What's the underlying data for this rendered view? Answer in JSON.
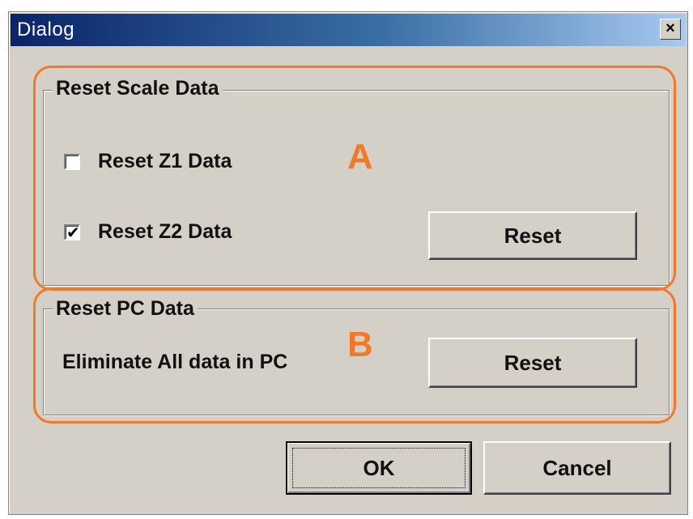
{
  "window": {
    "title": "Dialog",
    "close_glyph": "×"
  },
  "group_a": {
    "legend": "Reset Scale Data",
    "marker": "A",
    "checkboxes": [
      {
        "label": "Reset Z1 Data",
        "checked": false
      },
      {
        "label": "Reset Z2 Data",
        "checked": true
      }
    ],
    "reset_label": "Reset"
  },
  "group_b": {
    "legend": "Reset PC Data",
    "marker": "B",
    "description": "Eliminate All data in PC",
    "reset_label": "Reset"
  },
  "footer": {
    "ok_label": "OK",
    "cancel_label": "Cancel"
  },
  "colors": {
    "highlight": "#f07a2a",
    "title_gradient_start": "#0a246a",
    "face": "#d4d0c8"
  }
}
